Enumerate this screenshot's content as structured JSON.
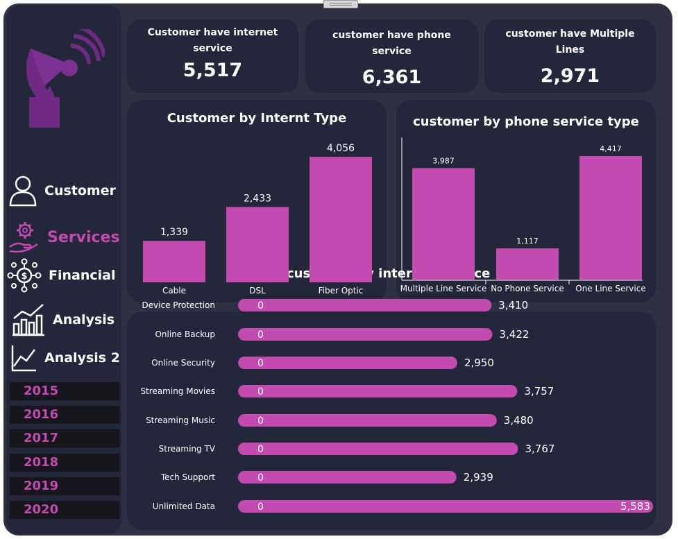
{
  "nav": {
    "items": [
      {
        "label": "Customer",
        "icon": "user-icon"
      },
      {
        "label": "Services",
        "icon": "gear-hand-icon"
      },
      {
        "label": "Financial",
        "icon": "dollar-network-icon"
      },
      {
        "label": "Analysis",
        "icon": "bar-chart-icon"
      },
      {
        "label": "Analysis 2",
        "icon": "line-chart-icon"
      }
    ],
    "active": "Services",
    "years": [
      "2015",
      "2016",
      "2017",
      "2018",
      "2019",
      "2020"
    ]
  },
  "kpis": [
    {
      "title": "Customer have internet service",
      "value": "5,517"
    },
    {
      "title": "customer have phone service",
      "value": "6,361"
    },
    {
      "title": "customer have Multiple Lines",
      "value": "2,971"
    }
  ],
  "colors": {
    "accent": "#c24ab1",
    "panel": "#24263a",
    "background": "#2f3142"
  },
  "chart_data": [
    {
      "type": "bar",
      "title": "Customer by Internt Type",
      "categories": [
        "Cable",
        "DSL",
        "Fiber Optic"
      ],
      "values": [
        1339,
        2433,
        4056
      ],
      "value_labels": [
        "1,339",
        "2,433",
        "4,056"
      ],
      "ylim": [
        0,
        4056
      ]
    },
    {
      "type": "bar",
      "title": "customer by phone service type",
      "categories": [
        "Multiple Line Service",
        "No Phone Service",
        "One Line Service"
      ],
      "values": [
        3987,
        1117,
        4417
      ],
      "value_labels": [
        "3,987",
        "1,117",
        "4,417"
      ],
      "ylim": [
        0,
        4417
      ]
    },
    {
      "type": "bar",
      "orientation": "horizontal",
      "title": "customer by internet service",
      "categories": [
        "Device Protection",
        "Online Backup",
        "Online Security",
        "Streaming Movies",
        "Streaming Music",
        "Streaming TV",
        "Tech Support",
        "Unlimited Data"
      ],
      "values": [
        3410,
        3422,
        2950,
        3757,
        3480,
        3767,
        2939,
        5583
      ],
      "value_labels": [
        "3,410",
        "3,422",
        "2,950",
        "3,757",
        "3,480",
        "3,767",
        "2,939",
        "5,583"
      ],
      "start_labels": [
        "0",
        "0",
        "0",
        "0",
        "0",
        "0",
        "0",
        "0"
      ],
      "xlim": [
        0,
        5583
      ]
    }
  ]
}
